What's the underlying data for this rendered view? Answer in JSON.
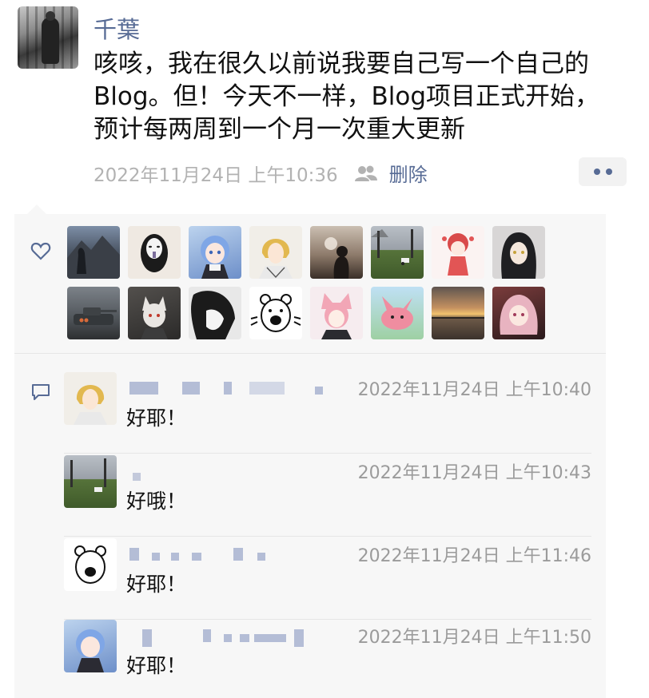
{
  "post": {
    "username": "千葉",
    "text": "咳咳，我在很久以前说我要自己写一个自己的Blog。但！今天不一样，Blog项目正式开始，预计每两周到一个月一次重大更新",
    "timestamp": "2022年11月24日 上午10:36",
    "delete_label": "删除"
  },
  "likes": {
    "count": 16,
    "avatars": [
      {
        "icon": "mountain-photo"
      },
      {
        "icon": "no-face-mask"
      },
      {
        "icon": "anime-blue-hair"
      },
      {
        "icon": "anime-blonde"
      },
      {
        "icon": "silhouette-photo"
      },
      {
        "icon": "park-photo"
      },
      {
        "icon": "anime-red-chibi"
      },
      {
        "icon": "anime-dark-hair"
      },
      {
        "icon": "tank-photo"
      },
      {
        "icon": "anime-white-cat"
      },
      {
        "icon": "manga-dark"
      },
      {
        "icon": "bear-sketch"
      },
      {
        "icon": "anime-pink-cat"
      },
      {
        "icon": "pink-creature"
      },
      {
        "icon": "sunset-photo"
      },
      {
        "icon": "anime-pink-hair"
      }
    ]
  },
  "comments": [
    {
      "avatar_icon": "anime-blonde",
      "time": "2022年11月24日 上午10:40",
      "text": "好耶！"
    },
    {
      "avatar_icon": "park-photo",
      "time": "2022年11月24日 上午10:43",
      "text": "好哦！"
    },
    {
      "avatar_icon": "bear-sketch",
      "time": "2022年11月24日 上午11:46",
      "text": "好耶！"
    },
    {
      "avatar_icon": "anime-blue-hair",
      "time": "2022年11月24日 上午11:50",
      "text": "好耶！"
    }
  ],
  "colors": {
    "link": "#576b95",
    "meta_gray": "#b2b2b2",
    "panel_bg": "#f7f7f7"
  }
}
